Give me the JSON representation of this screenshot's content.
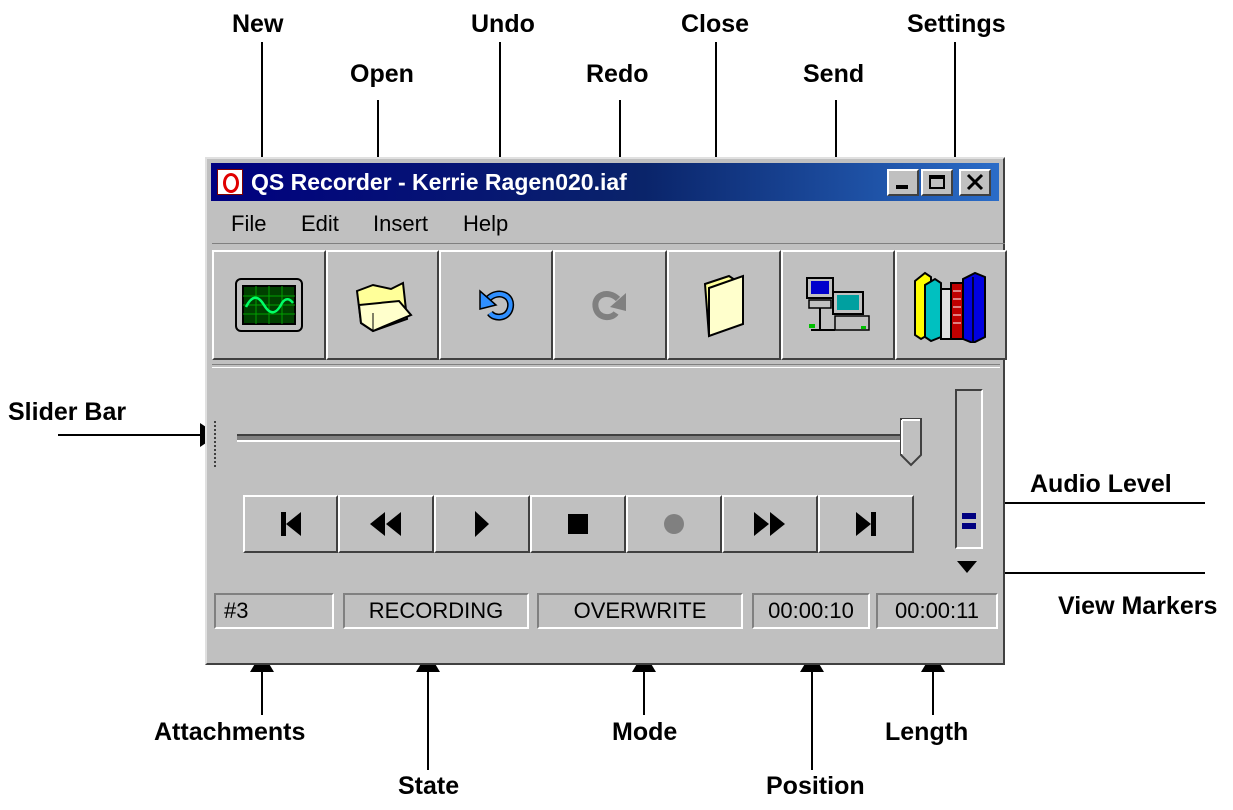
{
  "window": {
    "title": "QS Recorder - Kerrie Ragen020.iaf",
    "menu": [
      "File",
      "Edit",
      "Insert",
      "Help"
    ],
    "toolbar": [
      "new-waveform-icon",
      "open-folder-icon",
      "undo-arrow-icon",
      "redo-arrow-icon",
      "close-folder-icon",
      "send-computers-icon",
      "settings-books-icon"
    ],
    "transport": [
      "skip-to-start-icon",
      "rewind-icon",
      "play-icon",
      "stop-icon",
      "record-icon",
      "fast-forward-icon",
      "skip-to-end-icon"
    ],
    "slider_position": 0.98,
    "audio_level": 2,
    "status": {
      "attachments": "#3",
      "state": "RECORDING",
      "mode": "OVERWRITE",
      "position": "00:00:10",
      "length": "00:00:11"
    }
  },
  "callouts": {
    "new": "New",
    "open": "Open",
    "undo": "Undo",
    "redo": "Redo",
    "close": "Close",
    "send": "Send",
    "settings": "Settings",
    "slider_bar": "Slider Bar",
    "audio_level": "Audio Level",
    "view_markers": "View Markers",
    "attachments": "Attachments",
    "state": "State",
    "mode": "Mode",
    "position": "Position",
    "length": "Length"
  },
  "colors": {
    "window_face": "#c0c0c0",
    "titlebar": "#000080",
    "folder_yellow": "#ffff99",
    "level_blue": "#000080",
    "disabled_gray": "#808080"
  }
}
